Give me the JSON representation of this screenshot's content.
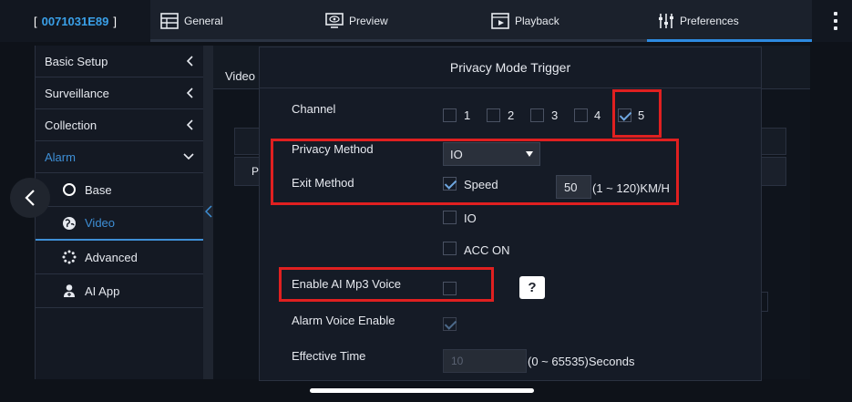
{
  "device": {
    "open_bracket": "[",
    "id": "0071031E89",
    "close_bracket": "]"
  },
  "nav": {
    "tabs": [
      {
        "label": "General",
        "icon": "grid-table-icon"
      },
      {
        "label": "Preview",
        "icon": "eye-monitor-icon"
      },
      {
        "label": "Playback",
        "icon": "film-play-icon"
      },
      {
        "label": "Preferences",
        "icon": "sliders-icon",
        "active": true
      }
    ]
  },
  "sidebar": {
    "items": [
      {
        "label": "Basic Setup"
      },
      {
        "label": "Surveillance"
      },
      {
        "label": "Collection"
      },
      {
        "label": "Alarm",
        "expanded": true
      }
    ],
    "alarm_sub": [
      {
        "label": "Base",
        "icon": "circle-icon"
      },
      {
        "label": "Video",
        "icon": "globe-icon",
        "active": true
      },
      {
        "label": "Advanced",
        "icon": "dotted-circle-icon"
      },
      {
        "label": "AI App",
        "icon": "user-doctor-icon"
      }
    ]
  },
  "background": {
    "tab_label": "Video",
    "row_letter": "P"
  },
  "modal": {
    "title": "Privacy Mode Trigger",
    "channel": {
      "label": "Channel",
      "options": [
        {
          "num": "1",
          "checked": false
        },
        {
          "num": "2",
          "checked": false
        },
        {
          "num": "3",
          "checked": false
        },
        {
          "num": "4",
          "checked": false
        },
        {
          "num": "5",
          "checked": true
        }
      ]
    },
    "privacy_method": {
      "label": "Privacy Method",
      "value": "IO"
    },
    "exit_method": {
      "label": "Exit Method",
      "speed_label": "Speed",
      "speed_checked": true,
      "speed_value": "50",
      "speed_range": "(1 ~ 120)KM/H",
      "io_label": "IO",
      "io_checked": false,
      "acc_label": "ACC ON",
      "acc_checked": false
    },
    "ai_voice": {
      "label": "Enable AI Mp3 Voice",
      "checked": false,
      "help": "?"
    },
    "alarm_voice": {
      "label": "Alarm Voice Enable",
      "checked": true
    },
    "effective_time": {
      "label": "Effective Time",
      "value": "10",
      "range": "(0 ~ 65535)Seconds"
    }
  },
  "colors": {
    "accent": "#2d8ae0",
    "highlight": "#e02020",
    "background": "#0e1219"
  }
}
